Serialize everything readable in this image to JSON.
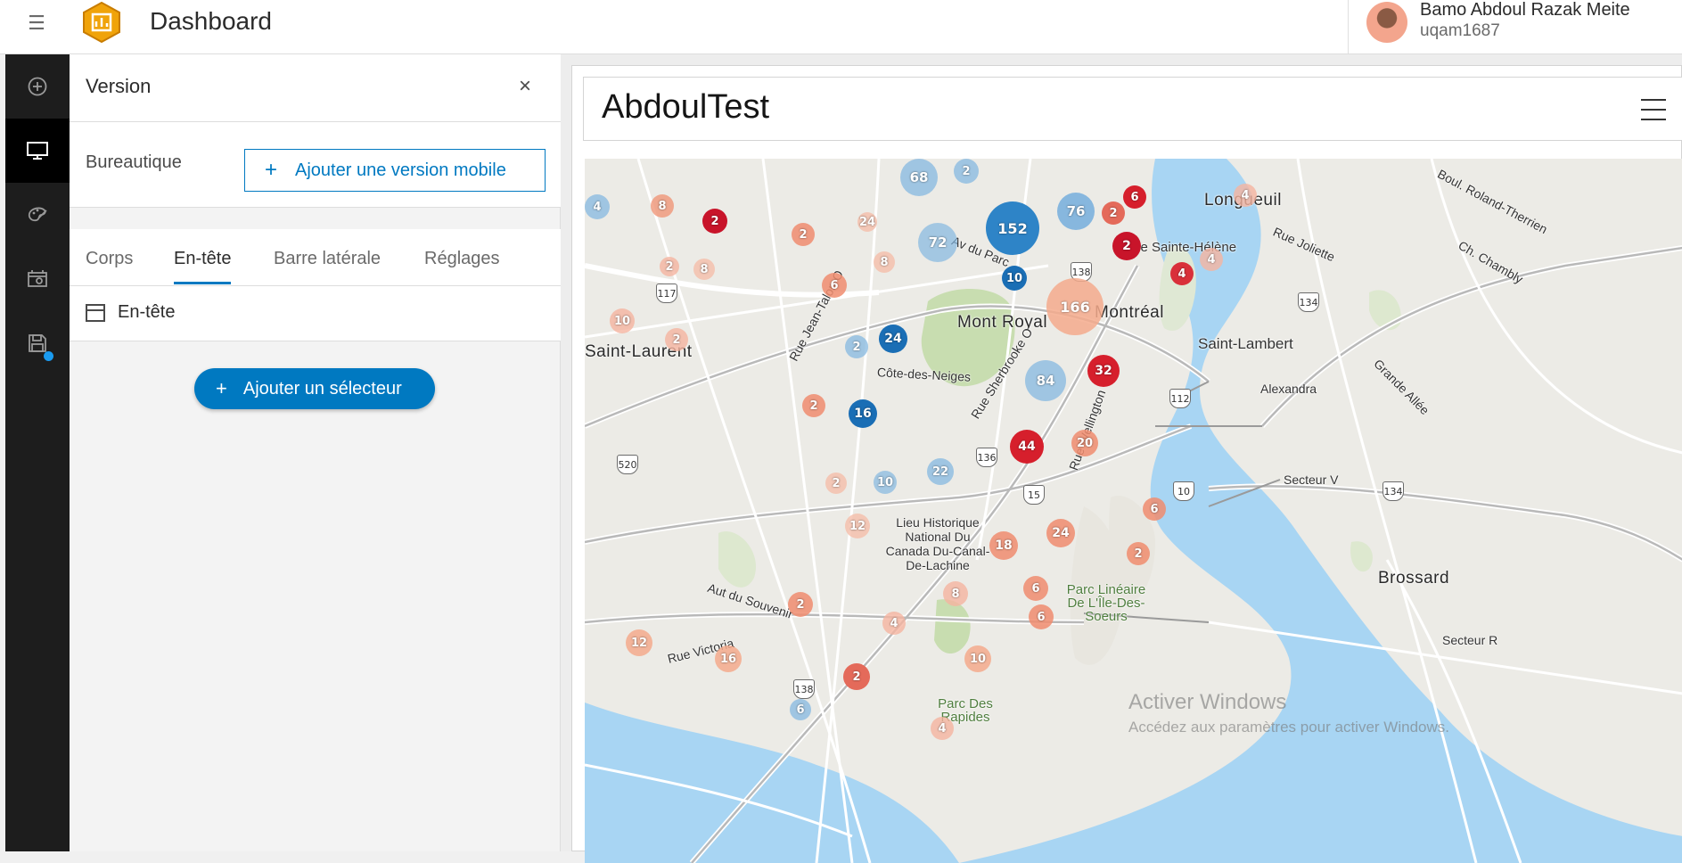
{
  "header": {
    "title": "Dashboard",
    "user_name": "Bamo Abdoul Razak Meite",
    "user_id": "uqam1687"
  },
  "rail": {
    "items": [
      {
        "icon": "add-circle-icon"
      },
      {
        "icon": "desktop-icon"
      },
      {
        "icon": "palette-icon"
      },
      {
        "icon": "settings-panel-icon"
      },
      {
        "icon": "save-icon"
      }
    ]
  },
  "panel": {
    "title": "Version",
    "version_label": "Bureautique",
    "add_mobile_label": "Ajouter une version mobile",
    "tabs": [
      "Corps",
      "En-tête",
      "Barre latérale",
      "Réglages"
    ],
    "active_tab": "En-tête",
    "header_item_label": "En-tête",
    "add_selector_label": "Ajouter un sélecteur"
  },
  "dashboard": {
    "title": "AbdoulTest"
  },
  "map": {
    "places": [
      "Longueuil",
      "Île Sainte-Hélène",
      "Mont Royal",
      "Montréal",
      "Saint-Laurent",
      "Saint-Lambert",
      "Alexandra",
      "Côte-des-Neiges",
      "Lieu Historique National Du Canada Du-Canal-De-Lachine",
      "Parc Linéaire De L'Île-Des-Soeurs",
      "Brossard",
      "Secteur V",
      "Secteur R",
      "Parc Des Rapides",
      "Rue Jean-Talon O",
      "Av du Parc",
      "Rue Sherbrooke O",
      "Rue Wellington",
      "Rue Victoria",
      "Aut du Souvenir",
      "Rue Joliette",
      "Ch. Chambly",
      "Grande Allée",
      "Boul. Roland-Therrien"
    ],
    "clusters": [
      68,
      2,
      76,
      152,
      2,
      6,
      2,
      24,
      4,
      8,
      4,
      2,
      72,
      2,
      8,
      2,
      8,
      10,
      166,
      6,
      4,
      4,
      24,
      2,
      10,
      2,
      84,
      32,
      2,
      16,
      44,
      20,
      22,
      2,
      10,
      6,
      24,
      12,
      18,
      2,
      8,
      6,
      6,
      2,
      4,
      12,
      16,
      10,
      2,
      6,
      4
    ],
    "watermark_title": "Activer Windows",
    "watermark_sub": "Accédez aux paramètres pour activer Windows."
  }
}
